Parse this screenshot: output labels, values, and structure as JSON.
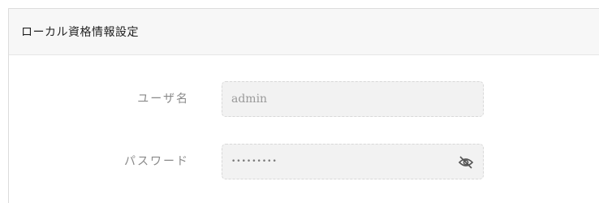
{
  "panel": {
    "title": "ローカル資格情報設定"
  },
  "form": {
    "username": {
      "label": "ユーザ名",
      "value": "admin"
    },
    "password": {
      "label": "パスワード",
      "masked_value": "•••••••••",
      "toggle_icon": "eye-off-icon"
    }
  },
  "colors": {
    "header_bg": "#f7f7f7",
    "field_bg": "#f2f2f2",
    "label_text": "#8a8a8a",
    "value_text": "#9a9a9a"
  }
}
